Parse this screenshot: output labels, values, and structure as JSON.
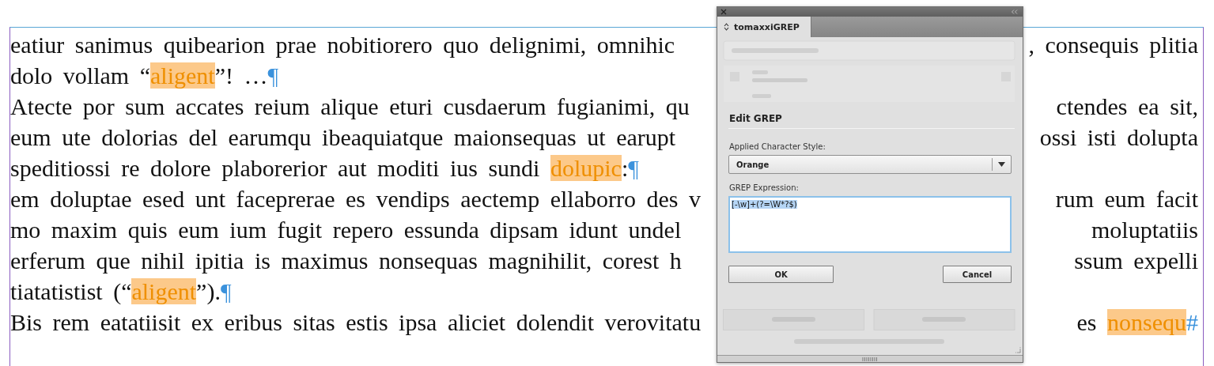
{
  "document": {
    "lines": [
      {
        "left": [
          {
            "kind": "text",
            "text": "eatiur sanimus quibearion prae nobitiorero quo delignimi, omnihic"
          }
        ],
        "right": [
          {
            "kind": "text",
            "text": ", consequis plitia"
          }
        ]
      },
      {
        "left": [
          {
            "kind": "text",
            "text": "dolo vollam “"
          },
          {
            "kind": "match",
            "text": "aligent"
          },
          {
            "kind": "text",
            "text": "”! …"
          },
          {
            "kind": "mark",
            "text": "¶"
          }
        ]
      },
      {
        "left": [
          {
            "kind": "text",
            "text": "Atecte por sum accates reium alique eturi cusdaerum fugianimi, qu"
          }
        ],
        "right": [
          {
            "kind": "text",
            "text": "ctendes ea sit,"
          }
        ]
      },
      {
        "left": [
          {
            "kind": "text",
            "text": "eum ute dolorias del earumqu ibeaquiatque maionsequas ut earupt"
          }
        ],
        "right": [
          {
            "kind": "text",
            "text": "ossi isti dolupta"
          }
        ]
      },
      {
        "left": [
          {
            "kind": "text",
            "text": "speditiossi re dolore plaborerior aut moditi ius sundi "
          },
          {
            "kind": "match",
            "text": "dolupic"
          },
          {
            "kind": "text",
            "text": ":"
          },
          {
            "kind": "mark",
            "text": "¶"
          }
        ]
      },
      {
        "left": [
          {
            "kind": "text",
            "text": "em doluptae esed unt faceprerae es vendips aectemp ellaborro des v"
          }
        ],
        "right": [
          {
            "kind": "text",
            "text": "rum eum facit"
          }
        ]
      },
      {
        "left": [
          {
            "kind": "text",
            "text": "mo maxim quis eum ium fugit repero essunda dipsam idunt undel"
          }
        ],
        "right": [
          {
            "kind": "text",
            "text": "moluptatiis"
          }
        ]
      },
      {
        "left": [
          {
            "kind": "text",
            "text": "erferum que nihil ipitia is maximus nonsequas magnihilit, corest h"
          }
        ],
        "right": [
          {
            "kind": "text",
            "text": "ssum expelli"
          }
        ]
      },
      {
        "left": [
          {
            "kind": "text",
            "text": "tiatatistist (“"
          },
          {
            "kind": "match",
            "text": "aligent"
          },
          {
            "kind": "text",
            "text": "”)."
          },
          {
            "kind": "mark",
            "text": "¶"
          }
        ]
      },
      {
        "left": [
          {
            "kind": "text",
            "text": "Bis rem eatatiisit ex eribus sitas estis ipsa aliciet dolendit verovitatu"
          }
        ],
        "right": [
          {
            "kind": "text",
            "text": "es "
          },
          {
            "kind": "match",
            "text": "nonsequ"
          },
          {
            "kind": "mark",
            "text": "#"
          }
        ]
      }
    ]
  },
  "panel": {
    "tab": {
      "label": "tomaxxiGREP",
      "selected": true
    },
    "dialog": {
      "title": "Edit GREP",
      "style_label": "Applied Character Style:",
      "style_value": "Orange",
      "expression_label": "GREP Expression:",
      "expression": "[-\\w]+(?=\\W*?$)",
      "expression_selected": true,
      "buttons": [
        {
          "label": "OK"
        },
        {
          "label": "Cancel"
        }
      ]
    }
  }
}
